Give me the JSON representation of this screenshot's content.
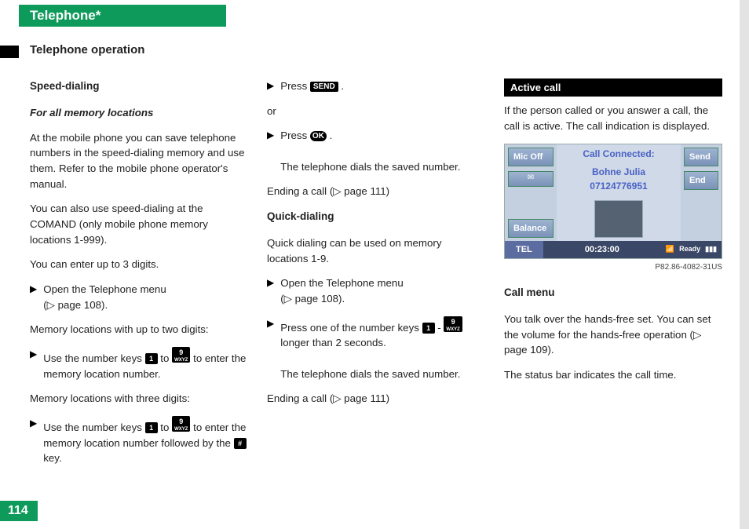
{
  "header": {
    "tab": "Telephone*",
    "section": "Telephone operation"
  },
  "page_number": "114",
  "col1": {
    "h_speed": "Speed-dialing",
    "h_forall": "For all memory locations",
    "p1": "At the mobile phone you can save telephone numbers in the speed-dialing memory and use them. Refer to the mobile phone operator's manual.",
    "p2": "You can also use speed-dialing at the COMAND (only mobile phone memory locations 1-999).",
    "p3": "You can enter up to 3 digits.",
    "s1": "Open the Telephone menu",
    "s1ref": "(▷ page 108).",
    "p4": "Memory locations with up to two digits:",
    "s2a": "Use the number keys ",
    "s2b": " to ",
    "s2c": " to enter the memory location number.",
    "p5": "Memory locations with three digits:",
    "s3a": "Use the number keys ",
    "s3b": " to ",
    "s3c": " to enter the memory location number followed by the ",
    "s3d": " key.",
    "key1": "1",
    "key9": "9",
    "key9sub": "WXYZ",
    "keyhash": "#"
  },
  "col2": {
    "s4a": "Press ",
    "s4key": "SEND",
    "s4b": ".",
    "or": "or",
    "s5a": "Press ",
    "s5key": "OK",
    "s5b": ".",
    "s5c": "The telephone dials the saved number.",
    "end1": "Ending a call (▷ page 111)",
    "h_quick": "Quick-dialing",
    "p_quick": "Quick dialing can be used on memory locations 1-9.",
    "s6": "Open the Telephone menu",
    "s6ref": "(▷ page 108).",
    "s7a": "Press one of the number keys ",
    "s7b": " - ",
    "s7c": " longer than 2 seconds.",
    "s7d": "The telephone dials the saved number.",
    "end2": "Ending a call (▷ page 111)"
  },
  "col3": {
    "h_active": "Active call",
    "p1": "If the person called or you answer a call, the call is active. The call indication is displayed.",
    "shot": {
      "mic": "Mic Off",
      "mail": "✉",
      "balance": "Balance",
      "send": "Send",
      "end": "End",
      "connected": "Call  Connected:",
      "name": "Bohne  Julia",
      "number": "07124776951",
      "tel": "TEL",
      "time": "00:23:00",
      "ready": "Ready"
    },
    "caption": "P82.86-4082-31US",
    "h_callmenu": "Call menu",
    "p2": "You talk over the hands-free set. You can set the volume for the hands-free operation (▷ page 109).",
    "p3": "The status bar indicates the call time."
  }
}
